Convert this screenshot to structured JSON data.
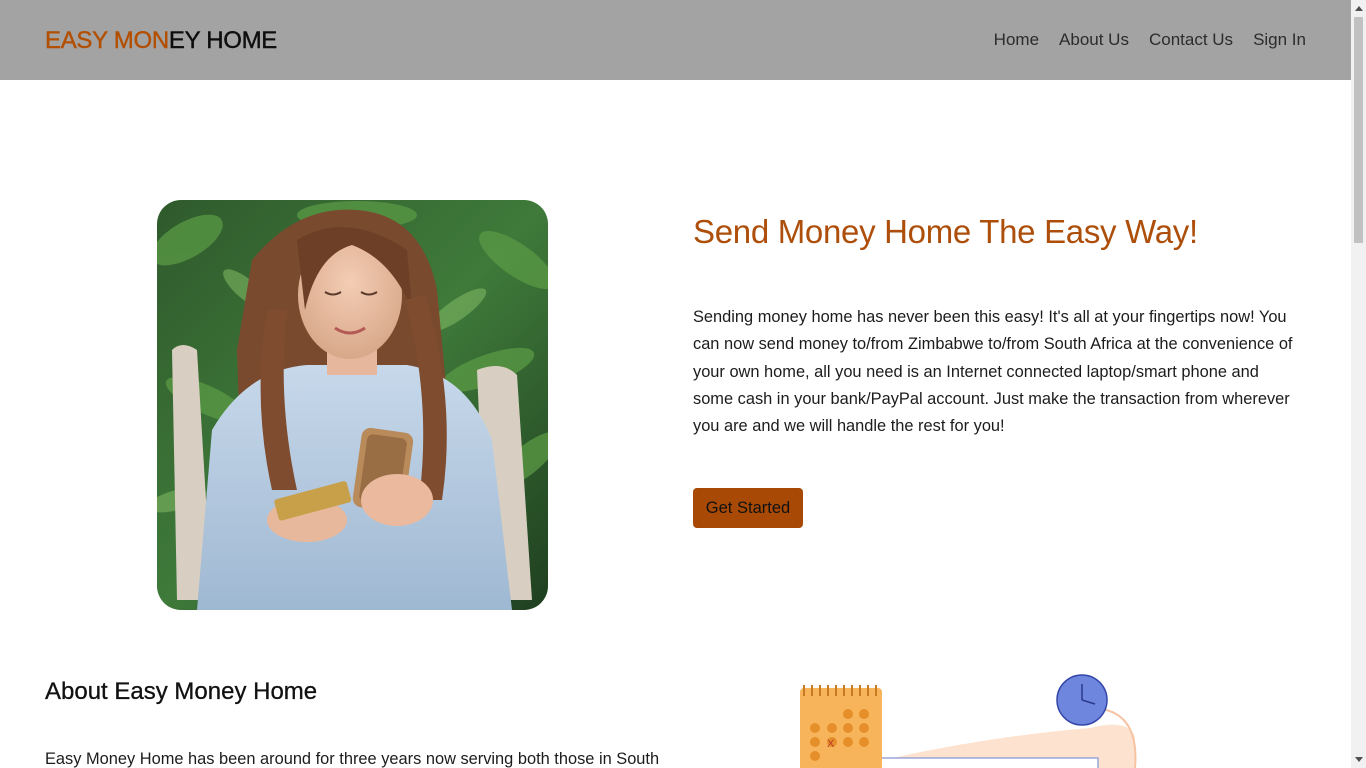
{
  "header": {
    "brand_part1": "EASY MON",
    "brand_part2": "EY HOME",
    "nav": [
      "Home",
      "About Us",
      "Contact Us",
      "Sign In"
    ]
  },
  "hero": {
    "title": "Send Money Home The Easy Way!",
    "paragraph": "Sending money home has never been this easy! It's all at your fingertips now! You can now send money to/from Zimbabwe to/from South Africa at the convenience of your own home, all you need is an Internet connected laptop/smart phone and some cash in your bank/PayPal account. Just make the transaction from wherever you are and we will handle the rest for you!",
    "cta_label": "Get Started"
  },
  "about": {
    "title": "About Easy Money Home",
    "paragraph_start": "Easy Money Home has been around for three years now serving both those in South"
  },
  "colors": {
    "accent": "#ad4f0a",
    "button": "#a84a05",
    "header_bg": "#a3a3a3"
  },
  "icons": [
    "woman-with-phone-photo",
    "calendar-icon",
    "clock-icon",
    "scroll-up-arrow",
    "scroll-down-arrow"
  ]
}
